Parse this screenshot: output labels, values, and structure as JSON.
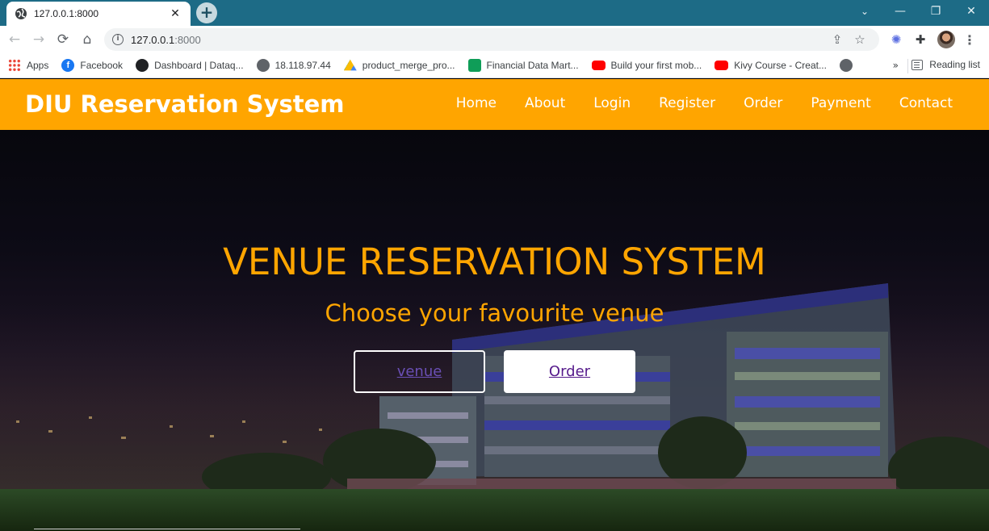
{
  "browser": {
    "tab": {
      "title": "127.0.0.1:8000",
      "close": "✕"
    },
    "new_tab": "+",
    "window_controls": {
      "tab_search": "⌄",
      "minimize": "—",
      "restore": "❐",
      "close": "✕"
    },
    "toolbar": {
      "back": "←",
      "forward": "→",
      "reload": "⟳",
      "home": "⌂",
      "url_host": "127.0.0.1",
      "url_port": ":8000",
      "info": "i",
      "share": "⇪",
      "bookmark_star": "☆",
      "extension": "✺",
      "puzzle": "✚",
      "menu": "⋮"
    },
    "bookmarks": [
      {
        "label": "Apps",
        "icon": "apps-icon"
      },
      {
        "label": "Facebook",
        "icon": "facebook-icon"
      },
      {
        "label": "Dashboard | Dataq...",
        "icon": "dashboard-icon"
      },
      {
        "label": "18.118.97.44",
        "icon": "globe-icon"
      },
      {
        "label": "product_merge_pro...",
        "icon": "google-drive-icon"
      },
      {
        "label": "Financial Data Mart...",
        "icon": "google-sheets-icon"
      },
      {
        "label": "Build your first mob...",
        "icon": "youtube-icon"
      },
      {
        "label": "Kivy Course - Creat...",
        "icon": "youtube-icon"
      }
    ],
    "bookmarks_more": "»",
    "reading_list": "Reading list"
  },
  "site": {
    "brand": "DIU Reservation System",
    "menu": [
      "Home",
      "About",
      "Login",
      "Register",
      "Order",
      "Payment",
      "Contact"
    ],
    "hero": {
      "title": "VENUE RESERVATION SYSTEM",
      "subtitle": "Choose your favourite venue",
      "venue_button": "venue",
      "order_button": "Order"
    }
  },
  "colors": {
    "accent": "#ffa500",
    "tabstrip": "#1d6b86",
    "link_purple": "#551a8b"
  }
}
